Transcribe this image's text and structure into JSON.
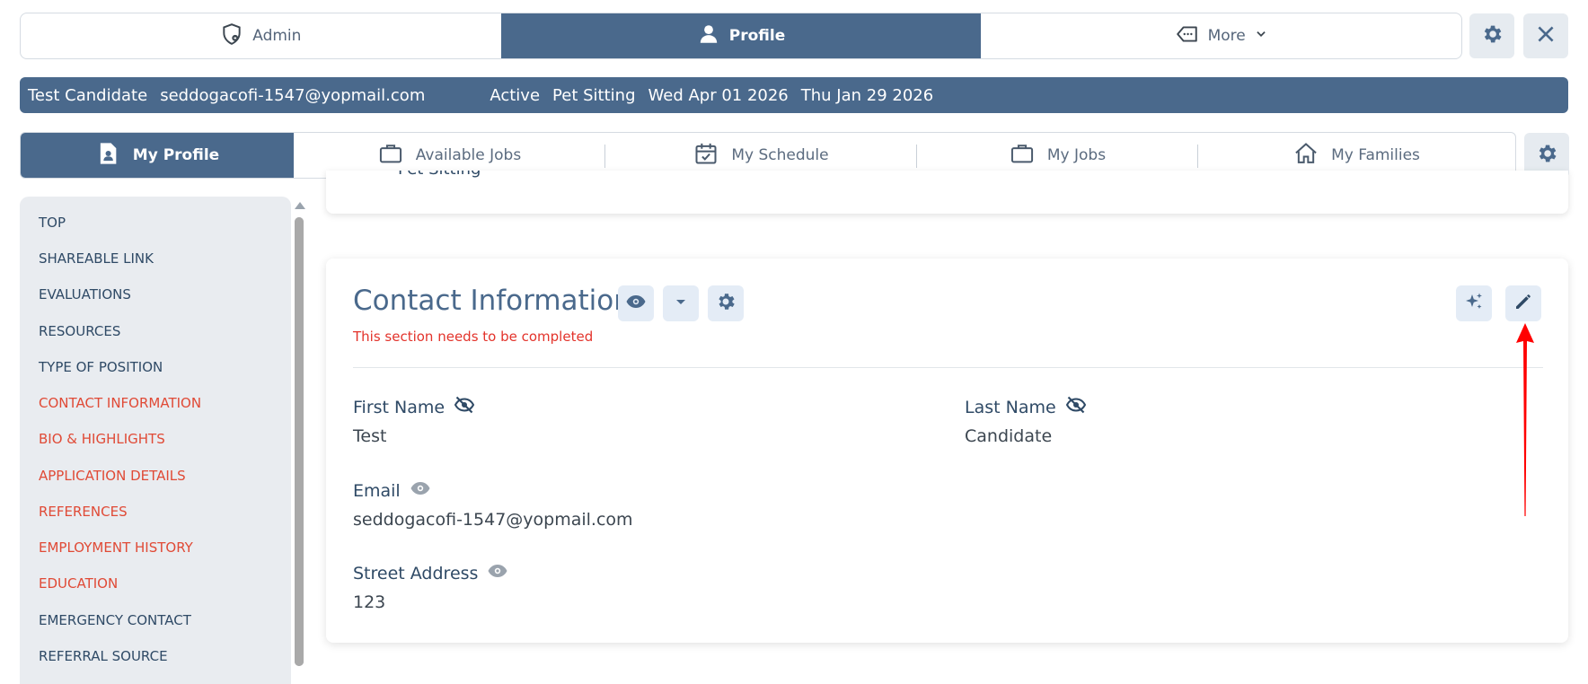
{
  "top_tabs": [
    {
      "label": "Admin",
      "icon": "shield-icon"
    },
    {
      "label": "Profile",
      "icon": "user-icon"
    },
    {
      "label": "More",
      "icon": "tag-icon"
    }
  ],
  "info_bar": {
    "name": "Test Candidate",
    "email": "seddogacofi-1547@yopmail.com",
    "status": "Active",
    "category": "Pet Sitting",
    "date1": "Wed Apr 01 2026",
    "date2": "Thu Jan 29 2026"
  },
  "sub_tabs": [
    {
      "label": "My Profile",
      "icon": "document-user-icon"
    },
    {
      "label": "Available Jobs",
      "icon": "briefcase-icon"
    },
    {
      "label": "My Schedule",
      "icon": "calendar-check-icon"
    },
    {
      "label": "My Jobs",
      "icon": "briefcase-icon"
    },
    {
      "label": "My Families",
      "icon": "home-icon"
    }
  ],
  "sidebar": {
    "items": [
      {
        "label": "TOP",
        "status": "ok"
      },
      {
        "label": "SHAREABLE LINK",
        "status": "ok"
      },
      {
        "label": "EVALUATIONS",
        "status": "ok"
      },
      {
        "label": "RESOURCES",
        "status": "ok"
      },
      {
        "label": "TYPE OF POSITION",
        "status": "ok"
      },
      {
        "label": "CONTACT INFORMATION",
        "status": "incomplete"
      },
      {
        "label": "BIO & HIGHLIGHTS",
        "status": "incomplete"
      },
      {
        "label": "APPLICATION DETAILS",
        "status": "incomplete"
      },
      {
        "label": "REFERENCES",
        "status": "incomplete"
      },
      {
        "label": "EMPLOYMENT HISTORY",
        "status": "incomplete"
      },
      {
        "label": "EDUCATION",
        "status": "incomplete"
      },
      {
        "label": "EMERGENCY CONTACT",
        "status": "ok"
      },
      {
        "label": "REFERRAL SOURCE",
        "status": "ok"
      }
    ]
  },
  "prev_card": {
    "cut_text": "Pet Sitting"
  },
  "contact": {
    "title": "Contact Information",
    "warning": "This section needs to be completed",
    "fields": {
      "first_name": {
        "label": "First Name",
        "value": "Test"
      },
      "last_name": {
        "label": "Last Name",
        "value": "Candidate"
      },
      "email": {
        "label": "Email",
        "value": "seddogacofi-1547@yopmail.com"
      },
      "street": {
        "label": "Street Address",
        "value": "123"
      }
    }
  },
  "colors": {
    "primary": "#4a698c",
    "warning": "#e3332b",
    "sidebar_bg": "#e9ecf0",
    "arrow": "#ff0000"
  }
}
